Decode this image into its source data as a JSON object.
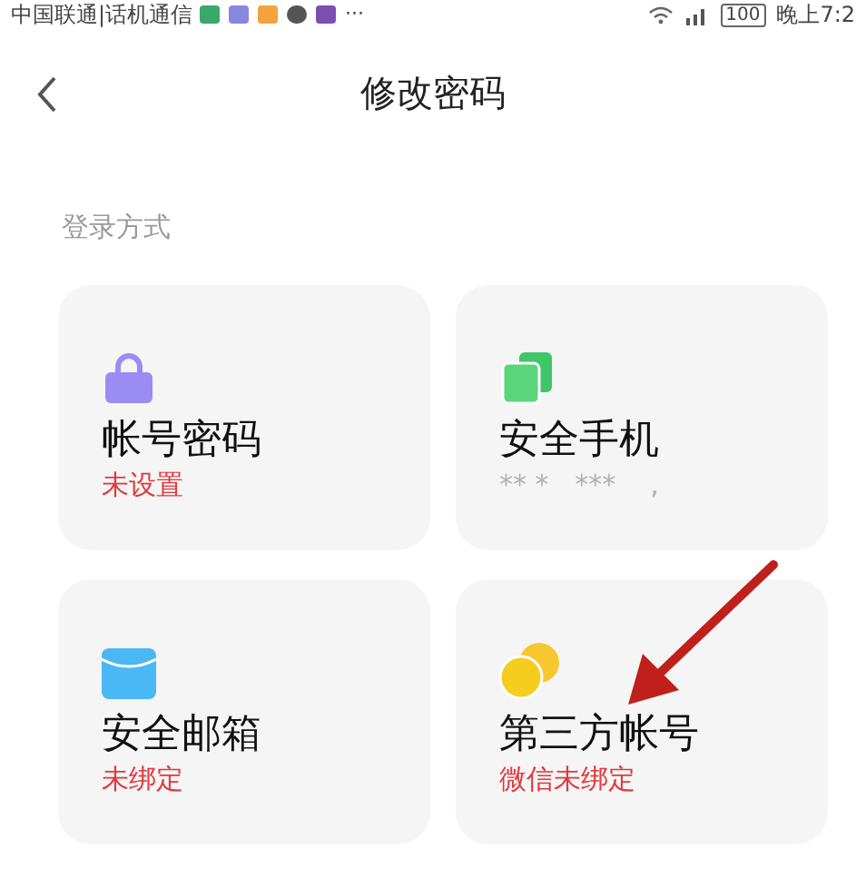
{
  "status_bar": {
    "carrier": "中国联通|话机通信",
    "more": "···",
    "battery": "100",
    "time": "晚上7:2"
  },
  "header": {
    "title": "修改密码"
  },
  "section": {
    "title": "登录方式"
  },
  "cards": [
    {
      "kind": "lock",
      "title": "帐号密码",
      "subtitle": "未设置",
      "warning": true
    },
    {
      "kind": "phone",
      "title": "安全手机",
      "subtitle": "** *   ***    ,",
      "warning": false
    },
    {
      "kind": "mail",
      "title": "安全邮箱",
      "subtitle": "未绑定",
      "warning": true
    },
    {
      "kind": "coins",
      "title": "第三方帐号",
      "subtitle": "微信未绑定",
      "warning": true
    }
  ],
  "annotation": {
    "kind": "arrow"
  }
}
